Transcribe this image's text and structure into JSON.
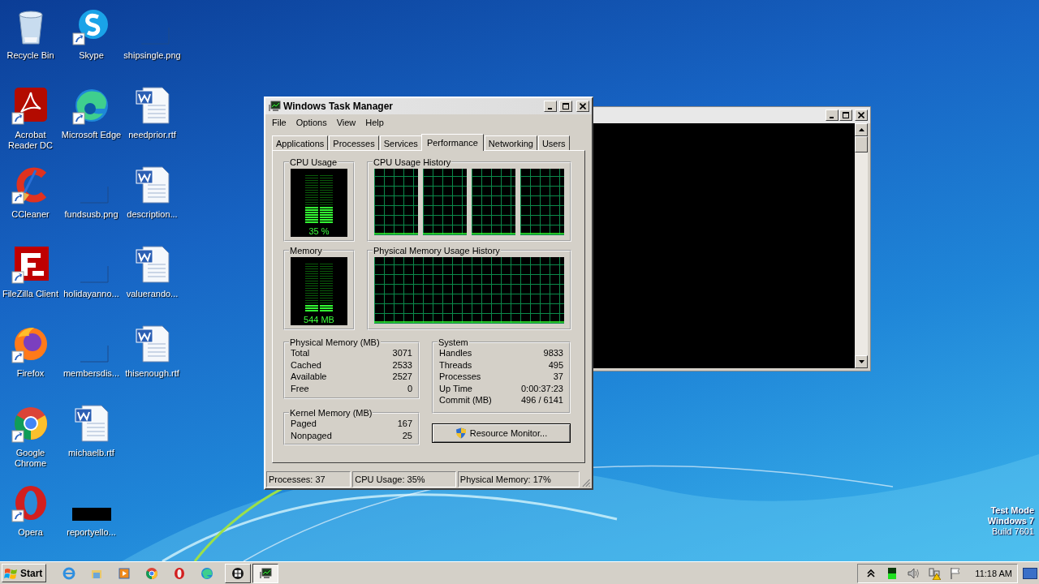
{
  "desktop_icons": [
    {
      "label": "Recycle Bin",
      "kind": "recycle",
      "shortcut": false
    },
    {
      "label": "Acrobat Reader DC",
      "kind": "acrobat",
      "shortcut": true
    },
    {
      "label": "CCleaner",
      "kind": "ccleaner",
      "shortcut": true
    },
    {
      "label": "FileZilla Client",
      "kind": "filezilla",
      "shortcut": true
    },
    {
      "label": "Firefox",
      "kind": "firefox",
      "shortcut": true
    },
    {
      "label": "Google Chrome",
      "kind": "chrome",
      "shortcut": true
    },
    {
      "label": "Opera",
      "kind": "opera",
      "shortcut": true
    },
    {
      "label": "Skype",
      "kind": "skype",
      "shortcut": true
    },
    {
      "label": "Microsoft Edge",
      "kind": "edge",
      "shortcut": true
    },
    {
      "label": "fundsusb.png",
      "kind": "image",
      "shortcut": false
    },
    {
      "label": "holidayanno...",
      "kind": "image",
      "shortcut": false
    },
    {
      "label": "membersdis...",
      "kind": "image",
      "shortcut": false
    },
    {
      "label": "michaelb.rtf",
      "kind": "word",
      "shortcut": false
    },
    {
      "label": "reportyello...",
      "kind": "black-image",
      "shortcut": false
    },
    {
      "label": "shipsingle.png",
      "kind": "image",
      "shortcut": false
    },
    {
      "label": "needprior.rtf",
      "kind": "word",
      "shortcut": false
    },
    {
      "label": "description...",
      "kind": "word",
      "shortcut": false
    },
    {
      "label": "valuerando...",
      "kind": "word",
      "shortcut": false
    },
    {
      "label": "thisenough.rtf",
      "kind": "word",
      "shortcut": false
    }
  ],
  "task_manager": {
    "title": "Windows Task Manager",
    "menu": [
      "File",
      "Options",
      "View",
      "Help"
    ],
    "tabs": [
      {
        "label": "Applications",
        "selected": false
      },
      {
        "label": "Processes",
        "selected": false
      },
      {
        "label": "Services",
        "selected": false
      },
      {
        "label": "Performance",
        "selected": true
      },
      {
        "label": "Networking",
        "selected": false
      },
      {
        "label": "Users",
        "selected": false
      }
    ],
    "cpu_usage": {
      "title": "CPU Usage",
      "reading": "35 %",
      "level": 0.35
    },
    "cpu_history": {
      "title": "CPU Usage History"
    },
    "memory": {
      "title": "Memory",
      "reading": "544 MB",
      "level": 0.17
    },
    "memory_history": {
      "title": "Physical Memory Usage History"
    },
    "physical_memory": {
      "title": "Physical Memory (MB)",
      "rows": [
        {
          "label": "Total",
          "value": "3071"
        },
        {
          "label": "Cached",
          "value": "2533"
        },
        {
          "label": "Available",
          "value": "2527"
        },
        {
          "label": "Free",
          "value": "0"
        }
      ]
    },
    "kernel_memory": {
      "title": "Kernel Memory (MB)",
      "rows": [
        {
          "label": "Paged",
          "value": "167"
        },
        {
          "label": "Nonpaged",
          "value": "25"
        }
      ]
    },
    "system": {
      "title": "System",
      "rows": [
        {
          "label": "Handles",
          "value": "9833"
        },
        {
          "label": "Threads",
          "value": "495"
        },
        {
          "label": "Processes",
          "value": "37"
        },
        {
          "label": "Up Time",
          "value": "0:00:37:23"
        },
        {
          "label": "Commit (MB)",
          "value": "496 / 6141"
        }
      ]
    },
    "resource_monitor_button": "Resource Monitor...",
    "status_bar": [
      "Processes: 37",
      "CPU Usage: 35%",
      "Physical Memory: 17%"
    ]
  },
  "desktop_notice": [
    {
      "text": "Test Mode",
      "bold": true
    },
    {
      "text": "Windows 7",
      "bold": true
    },
    {
      "text": "Build 7601",
      "bold": false
    }
  ],
  "taskbar": {
    "start": "Start",
    "quick_launch": [
      {
        "kind": "ie"
      },
      {
        "kind": "explorer"
      },
      {
        "kind": "media"
      },
      {
        "kind": "chrome"
      },
      {
        "kind": "opera"
      },
      {
        "kind": "edge"
      }
    ],
    "tasks": [
      {
        "kind": "windows",
        "selected": false
      },
      {
        "kind": "taskmgr",
        "selected": true
      }
    ],
    "clock": "11:18 AM"
  }
}
